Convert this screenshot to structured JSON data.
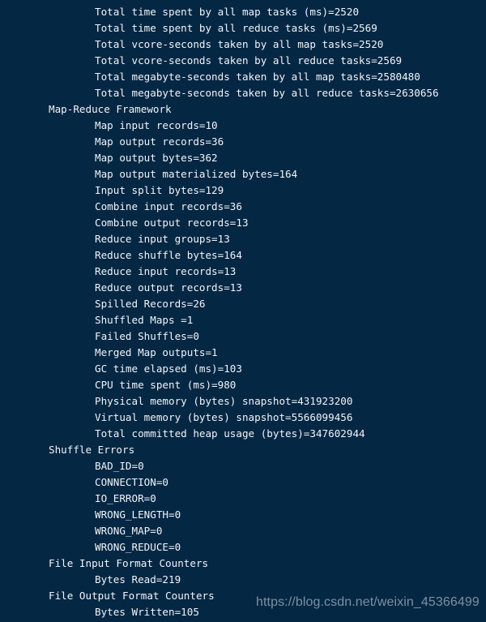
{
  "terminal": {
    "background_color": "#042744",
    "text_color": "#f2f4f6",
    "lines": [
      {
        "indent": 2,
        "text": "Total time spent by all map tasks (ms)=2520"
      },
      {
        "indent": 2,
        "text": "Total time spent by all reduce tasks (ms)=2569"
      },
      {
        "indent": 2,
        "text": "Total vcore-seconds taken by all map tasks=2520"
      },
      {
        "indent": 2,
        "text": "Total vcore-seconds taken by all reduce tasks=2569"
      },
      {
        "indent": 2,
        "text": "Total megabyte-seconds taken by all map tasks=2580480"
      },
      {
        "indent": 2,
        "text": "Total megabyte-seconds taken by all reduce tasks=2630656"
      },
      {
        "indent": 1,
        "text": "Map-Reduce Framework"
      },
      {
        "indent": 2,
        "text": "Map input records=10"
      },
      {
        "indent": 2,
        "text": "Map output records=36"
      },
      {
        "indent": 2,
        "text": "Map output bytes=362"
      },
      {
        "indent": 2,
        "text": "Map output materialized bytes=164"
      },
      {
        "indent": 2,
        "text": "Input split bytes=129"
      },
      {
        "indent": 2,
        "text": "Combine input records=36"
      },
      {
        "indent": 2,
        "text": "Combine output records=13"
      },
      {
        "indent": 2,
        "text": "Reduce input groups=13"
      },
      {
        "indent": 2,
        "text": "Reduce shuffle bytes=164"
      },
      {
        "indent": 2,
        "text": "Reduce input records=13"
      },
      {
        "indent": 2,
        "text": "Reduce output records=13"
      },
      {
        "indent": 2,
        "text": "Spilled Records=26"
      },
      {
        "indent": 2,
        "text": "Shuffled Maps =1"
      },
      {
        "indent": 2,
        "text": "Failed Shuffles=0"
      },
      {
        "indent": 2,
        "text": "Merged Map outputs=1"
      },
      {
        "indent": 2,
        "text": "GC time elapsed (ms)=103"
      },
      {
        "indent": 2,
        "text": "CPU time spent (ms)=980"
      },
      {
        "indent": 2,
        "text": "Physical memory (bytes) snapshot=431923200"
      },
      {
        "indent": 2,
        "text": "Virtual memory (bytes) snapshot=5566099456"
      },
      {
        "indent": 2,
        "text": "Total committed heap usage (bytes)=347602944"
      },
      {
        "indent": 1,
        "text": "Shuffle Errors"
      },
      {
        "indent": 2,
        "text": "BAD_ID=0"
      },
      {
        "indent": 2,
        "text": "CONNECTION=0"
      },
      {
        "indent": 2,
        "text": "IO_ERROR=0"
      },
      {
        "indent": 2,
        "text": "WRONG_LENGTH=0"
      },
      {
        "indent": 2,
        "text": "WRONG_MAP=0"
      },
      {
        "indent": 2,
        "text": "WRONG_REDUCE=0"
      },
      {
        "indent": 1,
        "text": "File Input Format Counters"
      },
      {
        "indent": 2,
        "text": "Bytes Read=219"
      },
      {
        "indent": 1,
        "text": "File Output Format Counters"
      },
      {
        "indent": 2,
        "text": "Bytes Written=105"
      }
    ]
  },
  "watermark": {
    "text": "https://blog.csdn.net/weixin_45366499",
    "color": "#9fadb9"
  }
}
